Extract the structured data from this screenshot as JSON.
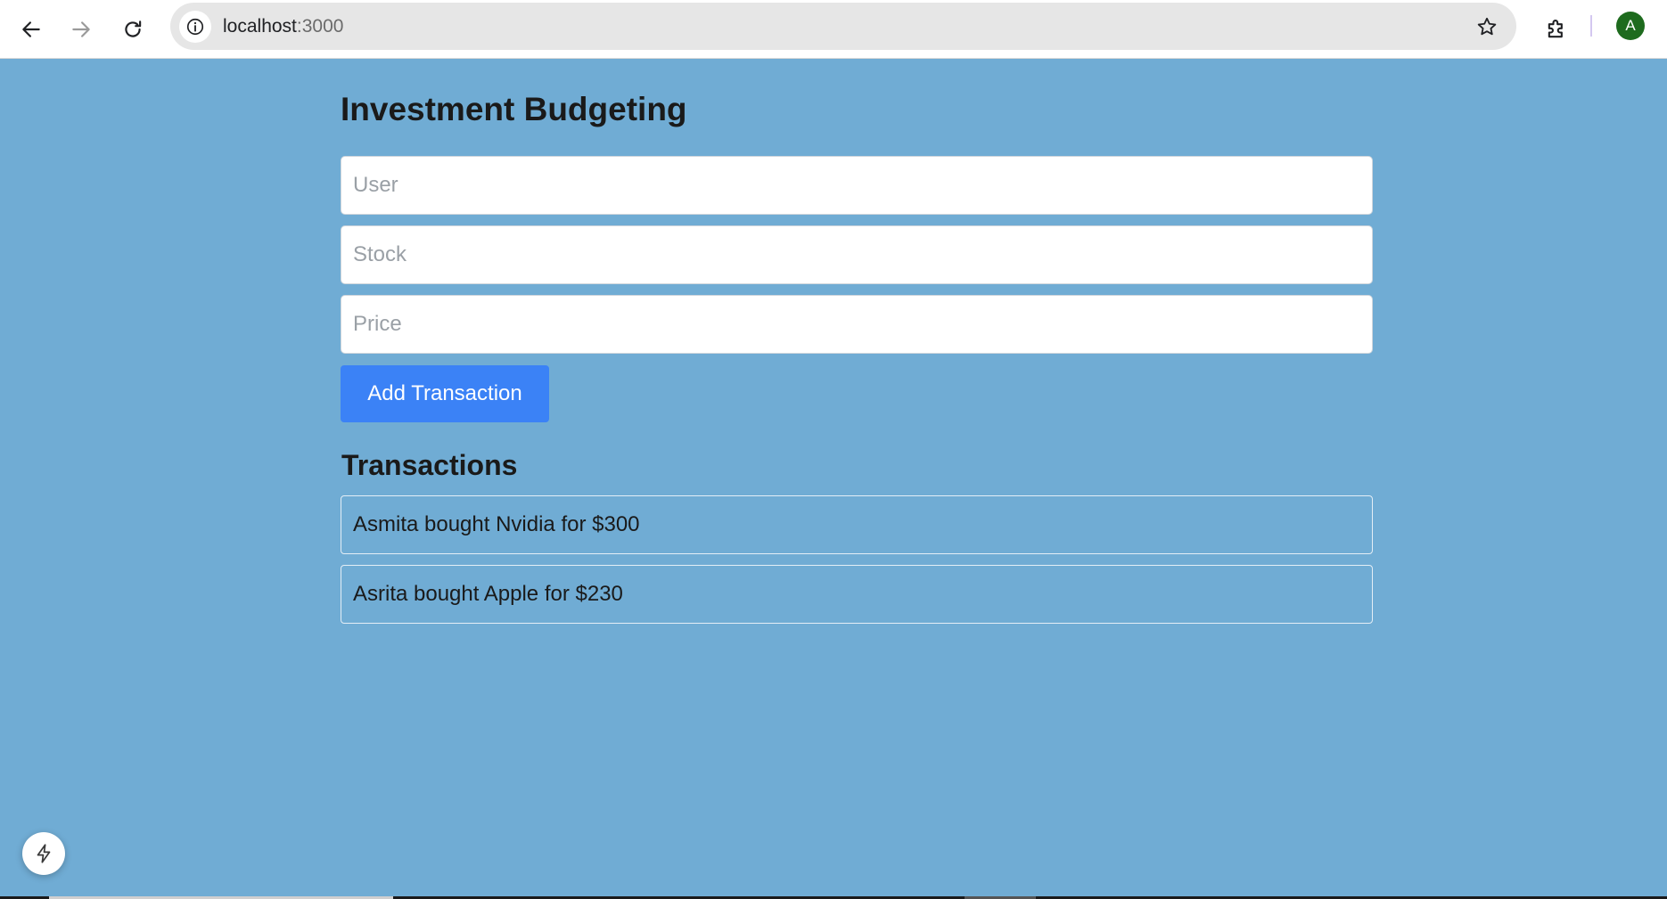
{
  "browser": {
    "url_host": "localhost",
    "url_port": ":3000",
    "avatar_letter": "A"
  },
  "page": {
    "title": "Investment Budgeting",
    "form": {
      "user_placeholder": "User",
      "stock_placeholder": "Stock",
      "price_placeholder": "Price",
      "user_value": "",
      "stock_value": "",
      "price_value": "",
      "submit_label": "Add Transaction"
    },
    "transactions_heading": "Transactions",
    "transactions": [
      "Asmita bought Nvidia for $300",
      "Asrita bought Apple for $230"
    ]
  },
  "colors": {
    "page_background": "#70acd4",
    "button_primary": "#3b82f6",
    "avatar": "#1e6b1e"
  },
  "icons": {
    "back": "arrow-left-icon",
    "forward": "arrow-right-icon",
    "reload": "reload-icon",
    "site_info": "info-icon",
    "bookmark": "star-icon",
    "extensions": "puzzle-icon",
    "dev_tools": "bolt-icon"
  }
}
